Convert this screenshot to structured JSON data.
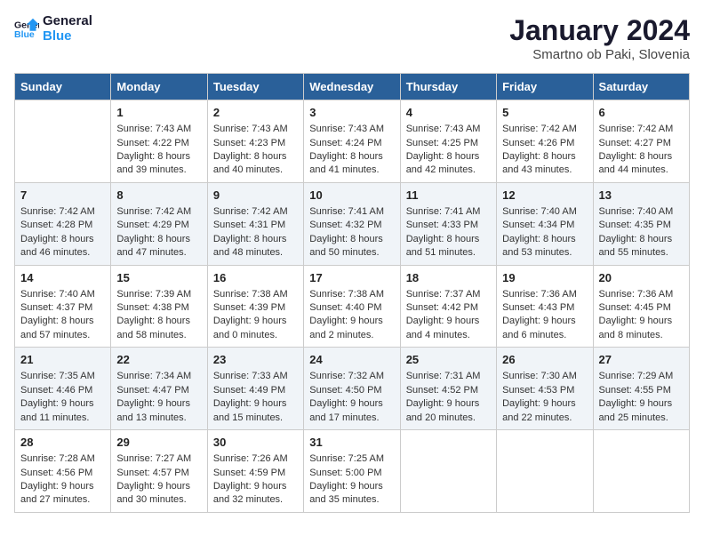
{
  "header": {
    "logo_line1": "General",
    "logo_line2": "Blue",
    "title": "January 2024",
    "subtitle": "Smartno ob Paki, Slovenia"
  },
  "weekdays": [
    "Sunday",
    "Monday",
    "Tuesday",
    "Wednesday",
    "Thursday",
    "Friday",
    "Saturday"
  ],
  "weeks": [
    [
      {
        "day": "",
        "content": ""
      },
      {
        "day": "1",
        "content": "Sunrise: 7:43 AM\nSunset: 4:22 PM\nDaylight: 8 hours\nand 39 minutes."
      },
      {
        "day": "2",
        "content": "Sunrise: 7:43 AM\nSunset: 4:23 PM\nDaylight: 8 hours\nand 40 minutes."
      },
      {
        "day": "3",
        "content": "Sunrise: 7:43 AM\nSunset: 4:24 PM\nDaylight: 8 hours\nand 41 minutes."
      },
      {
        "day": "4",
        "content": "Sunrise: 7:43 AM\nSunset: 4:25 PM\nDaylight: 8 hours\nand 42 minutes."
      },
      {
        "day": "5",
        "content": "Sunrise: 7:42 AM\nSunset: 4:26 PM\nDaylight: 8 hours\nand 43 minutes."
      },
      {
        "day": "6",
        "content": "Sunrise: 7:42 AM\nSunset: 4:27 PM\nDaylight: 8 hours\nand 44 minutes."
      }
    ],
    [
      {
        "day": "7",
        "content": "Sunrise: 7:42 AM\nSunset: 4:28 PM\nDaylight: 8 hours\nand 46 minutes."
      },
      {
        "day": "8",
        "content": "Sunrise: 7:42 AM\nSunset: 4:29 PM\nDaylight: 8 hours\nand 47 minutes."
      },
      {
        "day": "9",
        "content": "Sunrise: 7:42 AM\nSunset: 4:31 PM\nDaylight: 8 hours\nand 48 minutes."
      },
      {
        "day": "10",
        "content": "Sunrise: 7:41 AM\nSunset: 4:32 PM\nDaylight: 8 hours\nand 50 minutes."
      },
      {
        "day": "11",
        "content": "Sunrise: 7:41 AM\nSunset: 4:33 PM\nDaylight: 8 hours\nand 51 minutes."
      },
      {
        "day": "12",
        "content": "Sunrise: 7:40 AM\nSunset: 4:34 PM\nDaylight: 8 hours\nand 53 minutes."
      },
      {
        "day": "13",
        "content": "Sunrise: 7:40 AM\nSunset: 4:35 PM\nDaylight: 8 hours\nand 55 minutes."
      }
    ],
    [
      {
        "day": "14",
        "content": "Sunrise: 7:40 AM\nSunset: 4:37 PM\nDaylight: 8 hours\nand 57 minutes."
      },
      {
        "day": "15",
        "content": "Sunrise: 7:39 AM\nSunset: 4:38 PM\nDaylight: 8 hours\nand 58 minutes."
      },
      {
        "day": "16",
        "content": "Sunrise: 7:38 AM\nSunset: 4:39 PM\nDaylight: 9 hours\nand 0 minutes."
      },
      {
        "day": "17",
        "content": "Sunrise: 7:38 AM\nSunset: 4:40 PM\nDaylight: 9 hours\nand 2 minutes."
      },
      {
        "day": "18",
        "content": "Sunrise: 7:37 AM\nSunset: 4:42 PM\nDaylight: 9 hours\nand 4 minutes."
      },
      {
        "day": "19",
        "content": "Sunrise: 7:36 AM\nSunset: 4:43 PM\nDaylight: 9 hours\nand 6 minutes."
      },
      {
        "day": "20",
        "content": "Sunrise: 7:36 AM\nSunset: 4:45 PM\nDaylight: 9 hours\nand 8 minutes."
      }
    ],
    [
      {
        "day": "21",
        "content": "Sunrise: 7:35 AM\nSunset: 4:46 PM\nDaylight: 9 hours\nand 11 minutes."
      },
      {
        "day": "22",
        "content": "Sunrise: 7:34 AM\nSunset: 4:47 PM\nDaylight: 9 hours\nand 13 minutes."
      },
      {
        "day": "23",
        "content": "Sunrise: 7:33 AM\nSunset: 4:49 PM\nDaylight: 9 hours\nand 15 minutes."
      },
      {
        "day": "24",
        "content": "Sunrise: 7:32 AM\nSunset: 4:50 PM\nDaylight: 9 hours\nand 17 minutes."
      },
      {
        "day": "25",
        "content": "Sunrise: 7:31 AM\nSunset: 4:52 PM\nDaylight: 9 hours\nand 20 minutes."
      },
      {
        "day": "26",
        "content": "Sunrise: 7:30 AM\nSunset: 4:53 PM\nDaylight: 9 hours\nand 22 minutes."
      },
      {
        "day": "27",
        "content": "Sunrise: 7:29 AM\nSunset: 4:55 PM\nDaylight: 9 hours\nand 25 minutes."
      }
    ],
    [
      {
        "day": "28",
        "content": "Sunrise: 7:28 AM\nSunset: 4:56 PM\nDaylight: 9 hours\nand 27 minutes."
      },
      {
        "day": "29",
        "content": "Sunrise: 7:27 AM\nSunset: 4:57 PM\nDaylight: 9 hours\nand 30 minutes."
      },
      {
        "day": "30",
        "content": "Sunrise: 7:26 AM\nSunset: 4:59 PM\nDaylight: 9 hours\nand 32 minutes."
      },
      {
        "day": "31",
        "content": "Sunrise: 7:25 AM\nSunset: 5:00 PM\nDaylight: 9 hours\nand 35 minutes."
      },
      {
        "day": "",
        "content": ""
      },
      {
        "day": "",
        "content": ""
      },
      {
        "day": "",
        "content": ""
      }
    ]
  ]
}
